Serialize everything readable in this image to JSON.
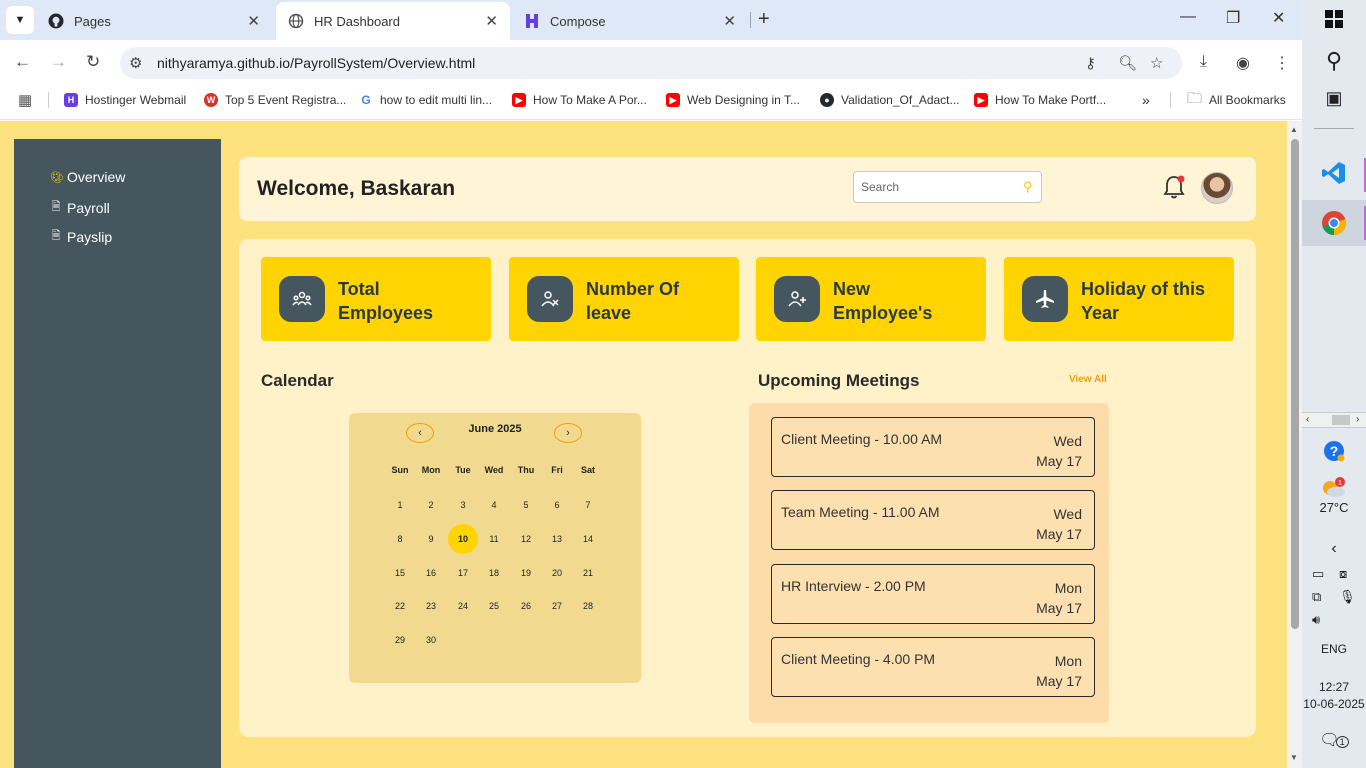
{
  "browser": {
    "tabs": [
      {
        "title": "Pages",
        "icon": "github-icon"
      },
      {
        "title": "HR Dashboard",
        "icon": "globe-icon"
      },
      {
        "title": "Compose",
        "icon": "hostinger-icon"
      }
    ],
    "url": "nithyaramya.github.io/PayrollSystem/Overview.html",
    "bookmarks": [
      {
        "label": "Hostinger Webmail",
        "icon": "hostinger-icon",
        "color": "#673de6"
      },
      {
        "label": "Top 5 Event Registra...",
        "icon": "w-icon",
        "color": "#d93025"
      },
      {
        "label": "how to edit multi lin...",
        "icon": "google-icon",
        "color": "#4285f4"
      },
      {
        "label": "How To Make A Por...",
        "icon": "youtube-icon",
        "color": "#ff0000"
      },
      {
        "label": "Web Designing in T...",
        "icon": "youtube-icon",
        "color": "#ff0000"
      },
      {
        "label": "Validation_Of_Adact...",
        "icon": "github-icon",
        "color": "#24292f"
      },
      {
        "label": "How To Make Portf...",
        "icon": "youtube-icon",
        "color": "#ff0000"
      }
    ],
    "all_bookmarks": "All Bookmarks"
  },
  "sidebar": {
    "items": [
      {
        "label": "Overview",
        "icon": "palette-icon"
      },
      {
        "label": "Payroll",
        "icon": "document-icon"
      },
      {
        "label": "Payslip",
        "icon": "document-icon"
      }
    ]
  },
  "header": {
    "welcome": "Welcome, Baskaran",
    "search_placeholder": "Search"
  },
  "cards": [
    {
      "line1": "Total",
      "line2": "Employees",
      "icon": "users-icon"
    },
    {
      "line1": "Number Of",
      "line2": "leave",
      "icon": "user-leave-icon"
    },
    {
      "line1": "New",
      "line2": "Employee's",
      "icon": "user-plus-icon"
    },
    {
      "line1": "Holiday of this",
      "line2": "Year",
      "icon": "plane-icon"
    }
  ],
  "calendar": {
    "title": "Calendar",
    "month": "June 2025",
    "prev": "‹",
    "next": "›",
    "dow": [
      "Sun",
      "Mon",
      "Tue",
      "Wed",
      "Thu",
      "Fri",
      "Sat"
    ],
    "weeks": [
      [
        "1",
        "2",
        "3",
        "4",
        "5",
        "6",
        "7"
      ],
      [
        "8",
        "9",
        "10",
        "11",
        "12",
        "13",
        "14"
      ],
      [
        "15",
        "16",
        "17",
        "18",
        "19",
        "20",
        "21"
      ],
      [
        "22",
        "23",
        "24",
        "25",
        "26",
        "27",
        "28"
      ],
      [
        "29",
        "30"
      ]
    ],
    "today": "10"
  },
  "meetings": {
    "title": "Upcoming Meetings",
    "view_all": "View All",
    "items": [
      {
        "title": "Client Meeting - 10.00 AM",
        "day": "Wed",
        "date": "May 17"
      },
      {
        "title": "Team Meeting - 11.00 AM",
        "day": "Wed",
        "date": "May 17"
      },
      {
        "title": "HR Interview - 2.00 PM",
        "day": "Mon",
        "date": "May 17"
      },
      {
        "title": "Client Meeting - 4.00 PM",
        "day": "Mon",
        "date": "May 17"
      }
    ]
  },
  "taskbar": {
    "weather_temp": "27°C",
    "weather_badge": "1",
    "language": "ENG",
    "time": "12:27",
    "date": "10-06-2025",
    "notification_count": "1"
  }
}
